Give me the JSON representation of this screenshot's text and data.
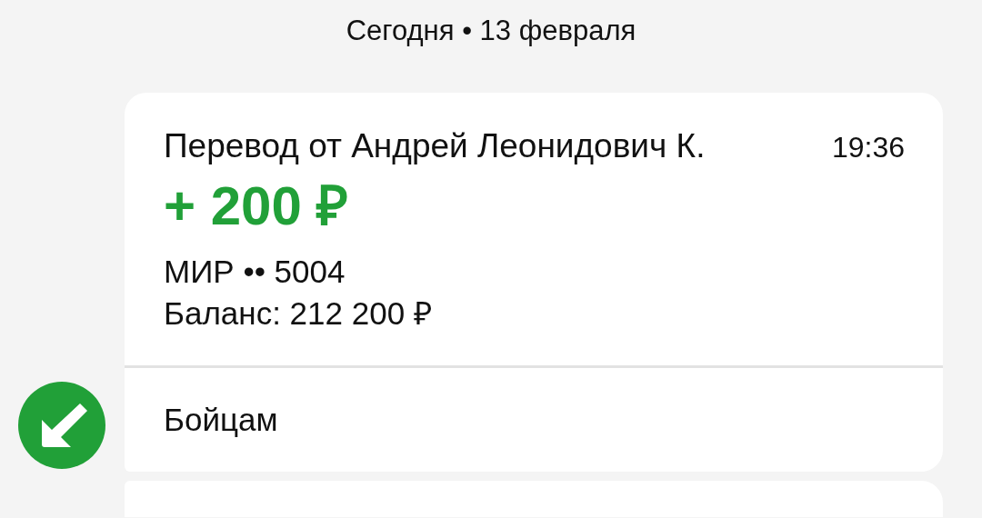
{
  "date_header": "Сегодня • 13 февраля",
  "message": {
    "title": "Перевод от Андрей Леонидович К.",
    "time": "19:36",
    "amount": "+ 200 ₽",
    "incoming": true,
    "card": "МИР •• 5004",
    "balance": "Баланс: 212 200 ₽",
    "comment": "Бойцам"
  }
}
